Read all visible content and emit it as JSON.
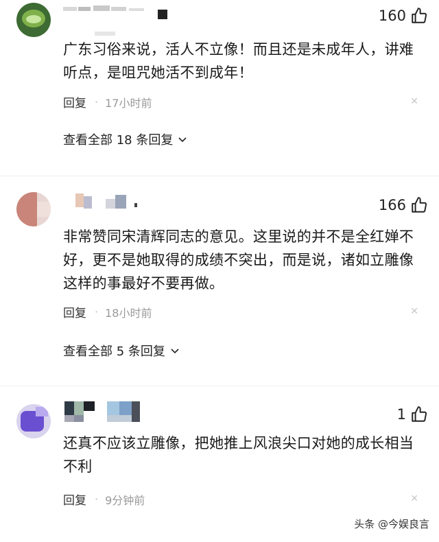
{
  "comments": [
    {
      "likes": "160",
      "text": "广东习俗来说，活人不立像！而且还是未成年人，讲难听点，是咀咒她活不到成年！",
      "reply_label": "回复",
      "time": "17小时前",
      "view_all": "查看全部 18 条回复"
    },
    {
      "likes": "166",
      "text": "非常赞同宋清辉同志的意见。这里说的并不是全红婵不好，更不是她取得的成绩不突出，而是说，诸如立雕像这样的事最好不要再做。",
      "reply_label": "回复",
      "time": "18小时前",
      "view_all": "查看全部 5 条回复"
    },
    {
      "likes": "1",
      "text": "还真不应该立雕像，把她推上风浪尖口对她的成长相当不利",
      "reply_label": "回复",
      "time": "9分钟前"
    }
  ],
  "watermark": "头条 @今娱良言",
  "colors": {
    "like_icon": "#222222",
    "muted": "#9a9a9a"
  }
}
